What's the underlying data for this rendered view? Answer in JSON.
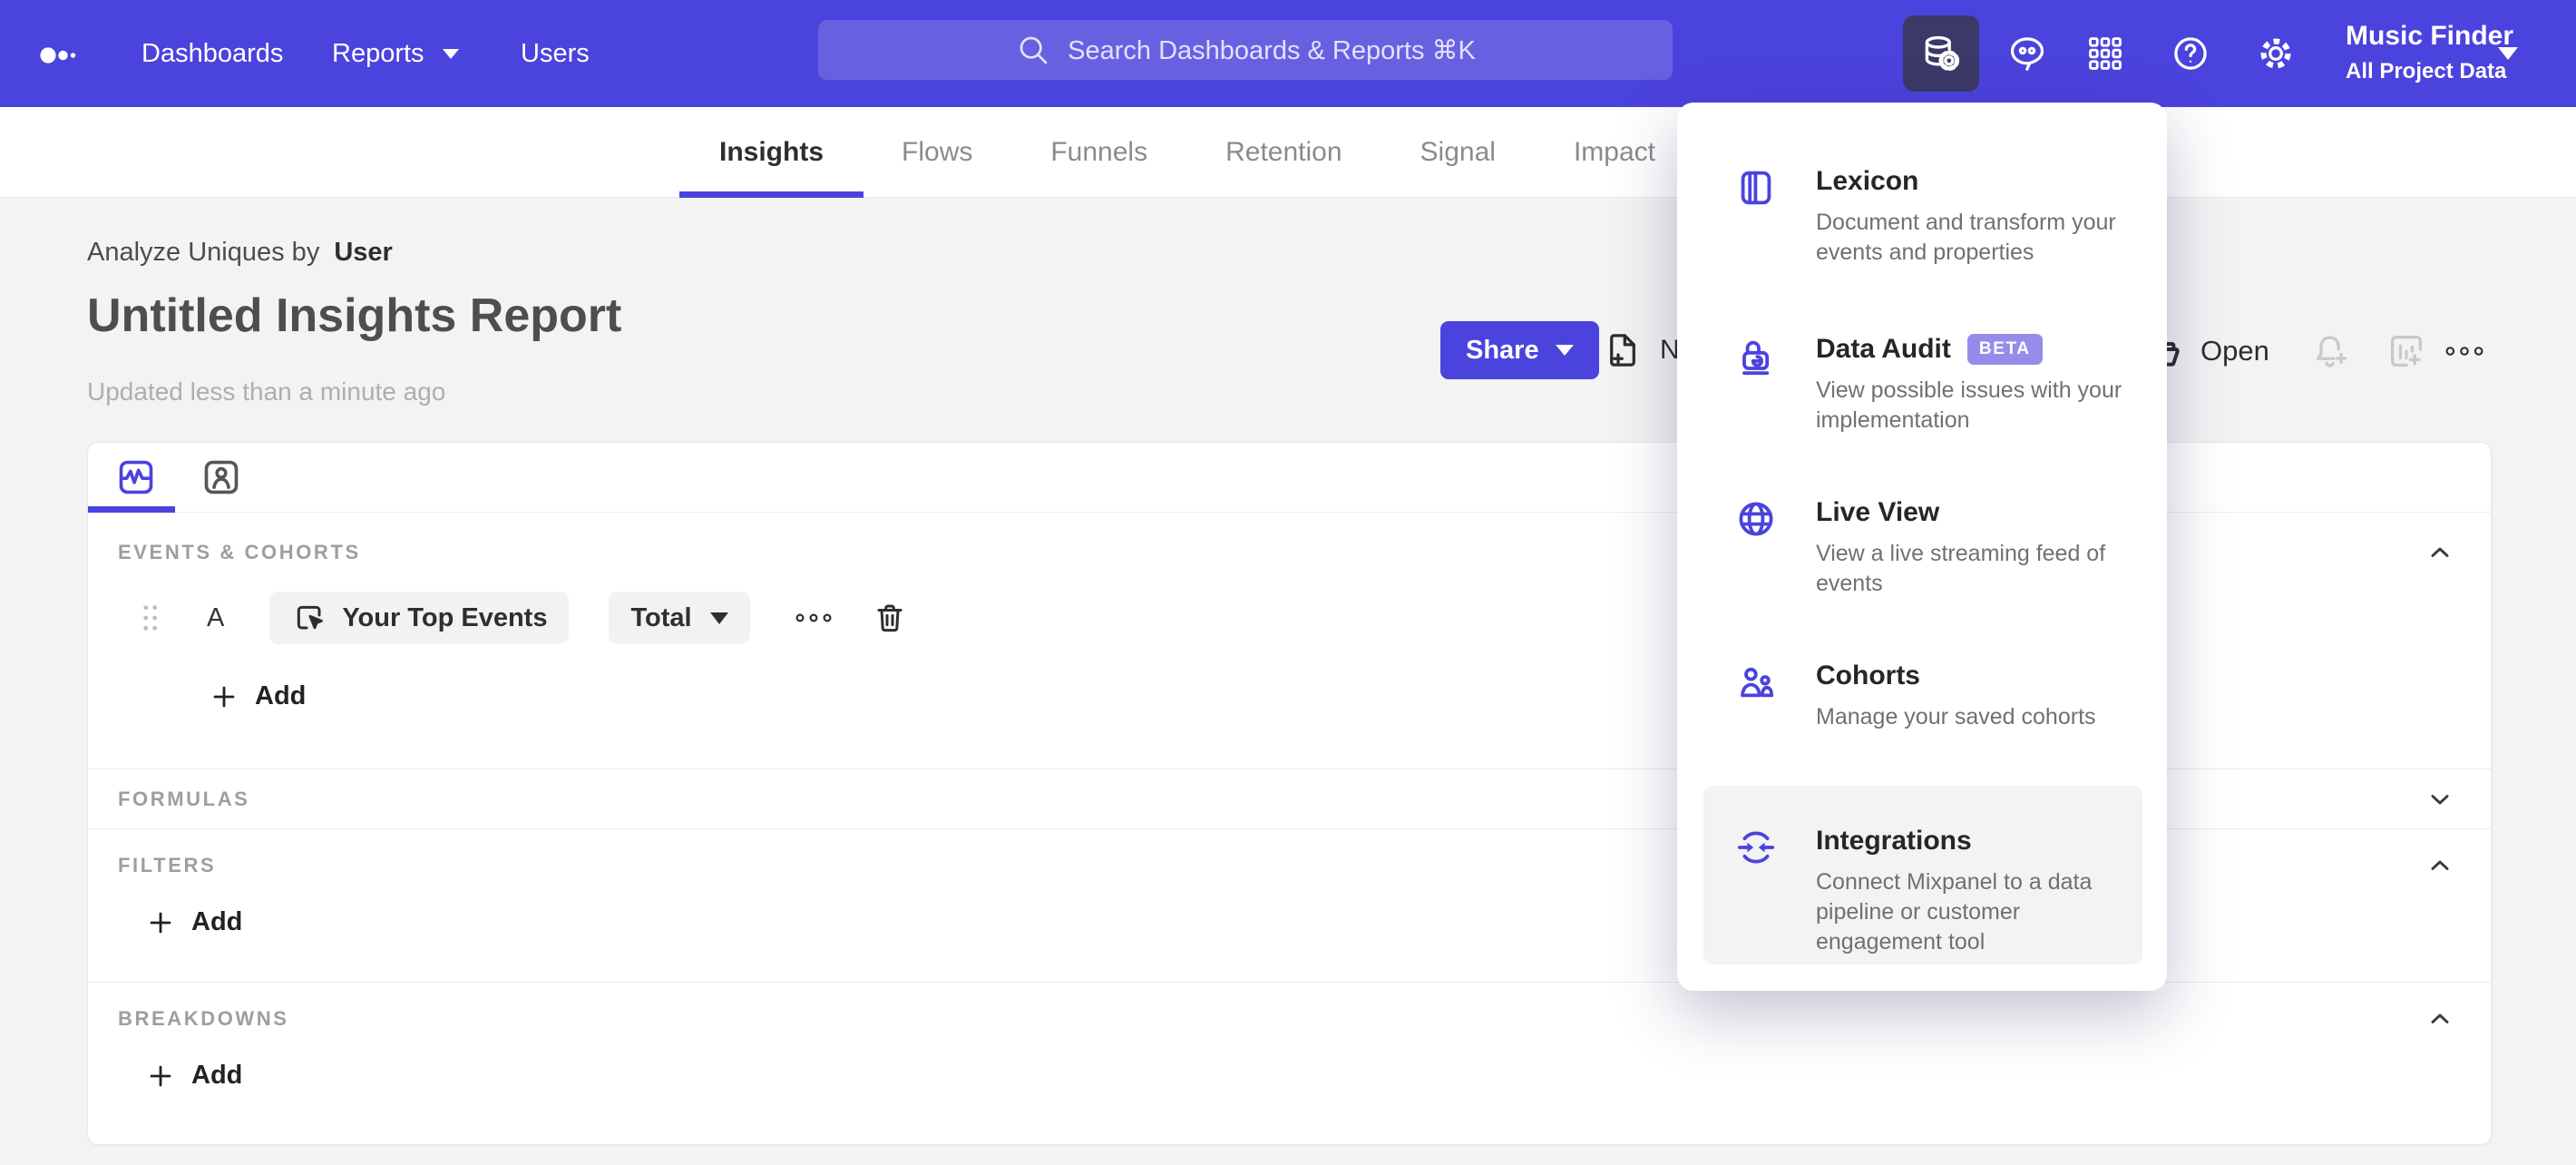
{
  "colors": {
    "accent": "#4b43dd",
    "nav_bg": "#4b43dd",
    "active_icon_bg": "#3b3967",
    "beta_badge": "#958ce9"
  },
  "nav": {
    "links": [
      {
        "label": "Dashboards"
      },
      {
        "label": "Reports"
      },
      {
        "label": "Users"
      }
    ],
    "search": {
      "placeholder": "Search Dashboards & Reports ⌘K"
    },
    "project": {
      "name": "Music Finder",
      "scope": "All Project Data"
    }
  },
  "tabs": [
    {
      "label": "Insights"
    },
    {
      "label": "Flows"
    },
    {
      "label": "Funnels"
    },
    {
      "label": "Retention"
    },
    {
      "label": "Signal"
    },
    {
      "label": "Impact"
    }
  ],
  "header": {
    "analyze_prefix": "Analyze Uniques by",
    "analyze_value": "User",
    "title": "Untitled Insights Report",
    "updated": "Updated less than a minute ago",
    "share_label": "Share",
    "new_label": "New",
    "open_label": "Open"
  },
  "builder": {
    "events_label": "EVENTS & COHORTS",
    "formulas_label": "FORMULAS",
    "filters_label": "FILTERS",
    "breakdowns_label": "BREAKDOWNS",
    "row": {
      "letter": "A",
      "event": "Your Top Events",
      "metric": "Total"
    },
    "add_label": "Add"
  },
  "menu": {
    "items": [
      {
        "title": "Lexicon",
        "desc": "Document and transform your events and properties"
      },
      {
        "title": "Data Audit",
        "badge": "BETA",
        "desc": "View possible issues with your implementation"
      },
      {
        "title": "Live View",
        "desc": "View a live streaming feed of events"
      },
      {
        "title": "Cohorts",
        "desc": "Manage your saved cohorts"
      },
      {
        "title": "Integrations",
        "desc": "Connect Mixpanel to a data pipeline or customer engagement tool"
      }
    ]
  }
}
